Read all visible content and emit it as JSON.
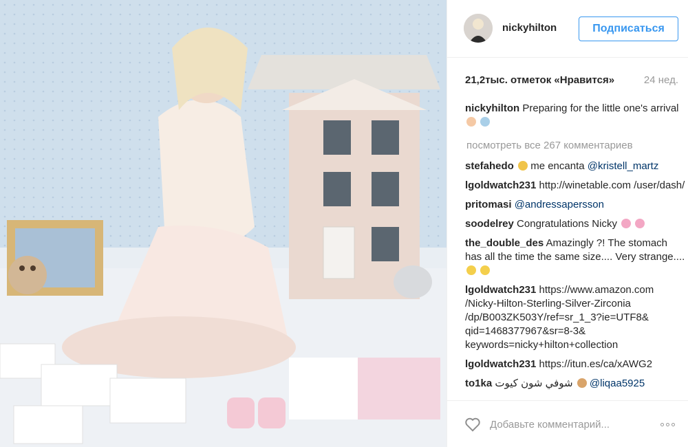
{
  "post": {
    "username": "nickyhilton",
    "follow_label": "Подписаться",
    "likes": "21,2тыс. отметок «Нравится»",
    "timestamp": "24 нед.",
    "caption": {
      "author": "nickyhilton",
      "text": "Preparing for the little one's arrival"
    },
    "load_more": "посмотреть все 267 комментариев",
    "comments": [
      {
        "author": "stefahedo",
        "text": " me encanta ",
        "mention": "@kristell_martz"
      },
      {
        "author": "lgoldwatch231",
        "text": " http://winetable.com /user/dash/",
        "mention": ""
      },
      {
        "author": "pritomasi",
        "text": " ",
        "mention": "@andressapersson"
      },
      {
        "author": "soodelrey",
        "text": " Congratulations Nicky ",
        "mention": ""
      },
      {
        "author": "the_double_des",
        "text": " Amazingly ?! The stomach has all the time the same size.... Very strange....",
        "mention": ""
      },
      {
        "author": "lgoldwatch231",
        "text": " https://www.amazon.com /Nicky-Hilton-Sterling-Silver-Zirconia /dp/B003ZK503Y/ref=sr_1_3?ie=UTF8& qid=1468377967&sr=8-3& keywords=nicky+hilton+collection",
        "mention": ""
      },
      {
        "author": "lgoldwatch231",
        "text": " https://itun.es/ca/xAWG2",
        "mention": ""
      },
      {
        "author": "to1ka",
        "text": " شوفي شون كيوت ",
        "mention": "@liqaa5925"
      }
    ],
    "comment_placeholder": "Добавьте комментарий...",
    "colors": {
      "accent": "#3897f0",
      "mention": "#003569",
      "muted": "#999999"
    },
    "icons": {
      "like": "heart-icon",
      "more": "more-options-icon"
    }
  }
}
